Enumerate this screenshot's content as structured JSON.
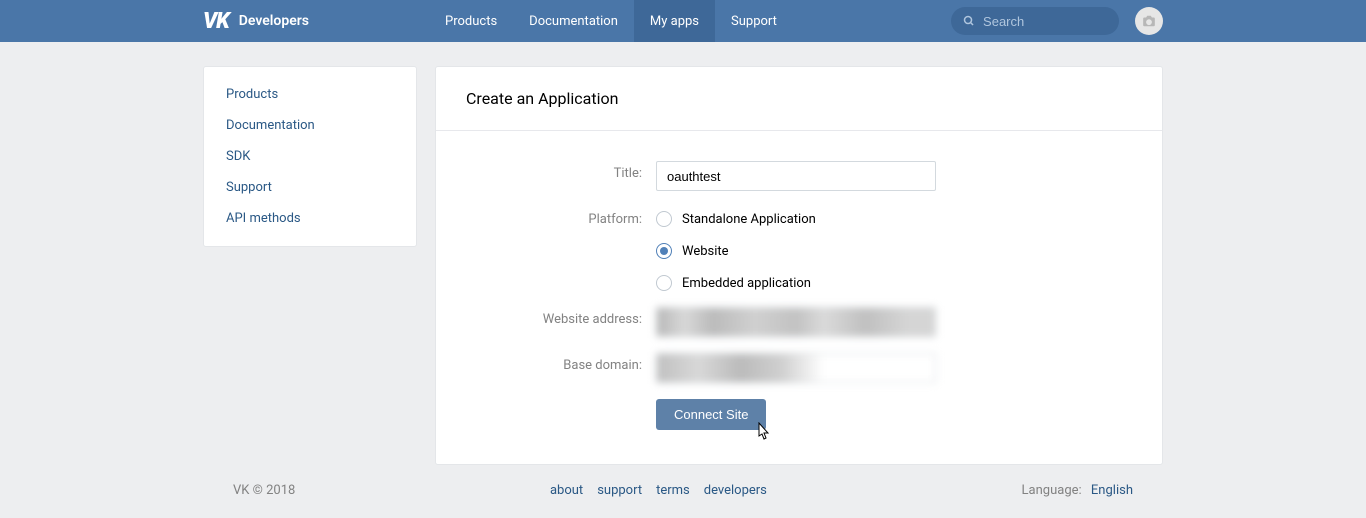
{
  "header": {
    "brand": "Developers",
    "nav": [
      "Products",
      "Documentation",
      "My apps",
      "Support"
    ],
    "active_nav": 2,
    "search_placeholder": "Search"
  },
  "sidebar": {
    "items": [
      "Products",
      "Documentation",
      "SDK",
      "Support",
      "API methods"
    ]
  },
  "page": {
    "title": "Create an Application",
    "labels": {
      "title": "Title:",
      "platform": "Platform:",
      "website_address": "Website address:",
      "base_domain": "Base domain:"
    },
    "title_value": "oauthtest",
    "platform_options": [
      "Standalone Application",
      "Website",
      "Embedded application"
    ],
    "platform_selected": 1,
    "submit_label": "Connect Site"
  },
  "footer": {
    "copyright": "VK © 2018",
    "links": [
      "about",
      "support",
      "terms",
      "developers"
    ],
    "language_label": "Language:",
    "language_value": "English"
  }
}
